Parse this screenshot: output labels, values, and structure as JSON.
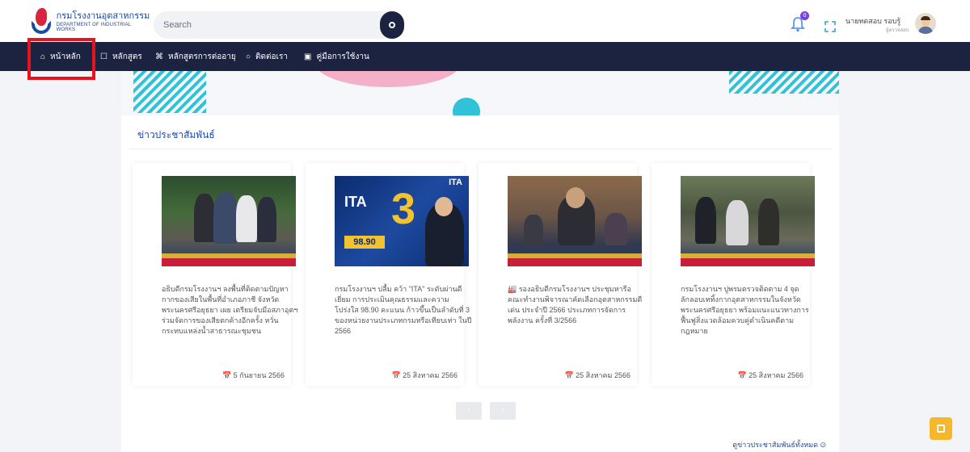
{
  "header": {
    "logo_th": "กรมโรงงานอุตสาหกรรม",
    "logo_en": "DEPARTMENT OF INDUSTRIAL WORKS",
    "search_placeholder": "Search",
    "notification_count": "0",
    "user_name": "นายทดสอบ รอบรู้",
    "user_role": "ผู้ตรวจสอบ"
  },
  "nav": {
    "items": [
      {
        "label": "หน้าหลัก",
        "icon": "home-icon"
      },
      {
        "label": "หลักสูตร",
        "icon": "book-icon"
      },
      {
        "label": "หลักสูตรการต่ออายุ",
        "icon": "command-icon"
      },
      {
        "label": "ติดต่อเรา",
        "icon": "chat-icon"
      },
      {
        "label": "คู่มือการใช้งาน",
        "icon": "manual-icon"
      }
    ]
  },
  "news": {
    "section_title": "ข่าวประชาสัมพันธ์",
    "cards": [
      {
        "desc": "อธิบดีกรมโรงงานฯ ลงพื้นที่ติดตามปัญหากากของเสียในพื้นที่อำเภอภาชี จังหวัดพระนครศรีอยุธยา เผย เตรียมจับมือสภาอุตฯ ร่วมจัดการของเสียตกค้างอีกครั้ง หวั่นกระทบแหล่งน้ำสาธารณะชุมชน",
        "date": "5 กันยายน 2566"
      },
      {
        "desc": "กรมโรงงานฯ ปลื้ม คว้า \"ITA\" ระดับผ่านดีเยี่ยม การประเมินคุณธรรมและความโปร่งใส 98.90 คะแนน ก้าวขึ้นเป็นลำดับที่ 3 ของหน่วยงานประเภทกรมหรือเทียบเท่า ในปี 2566",
        "date": "25 สิงหาคม 2566",
        "thumb_score": "98.90",
        "thumb_rank": "3",
        "thumb_ita": "ITA"
      },
      {
        "desc": "🏭 รองอธิบดีกรมโรงงานฯ ประชุมหารือคณะทำงานพิจารณาคัดเลือกอุตสาหกรรมดีเด่น ประจำปี 2566 ประเภทการจัดการพลังงาน ครั้งที่ 3/2566",
        "date": "25 สิงหาคม 2566"
      },
      {
        "desc": "กรมโรงงานฯ ปูพรมตรวจติดตาม 4 จุดลักลอบเททิ้งกากอุตสาหกรรมในจังหวัดพระนครศรีอยุธยา พร้อมแนะแนวทางการฟื้นฟูสิ่งแวดล้อมควบคู่ดำเนินคดีตามกฎหมาย",
        "date": "25 สิงหาคม 2566"
      }
    ],
    "pager_prev": "‹",
    "pager_next": "›",
    "more_link": "ดูข่าวประชาสัมพันธ์ทั้งหมด ⊙"
  },
  "colors": {
    "navbar": "#1c2340",
    "accent": "#1b4aa6",
    "highlight": "#e8141b",
    "scroll_button": "#f5b72b"
  }
}
